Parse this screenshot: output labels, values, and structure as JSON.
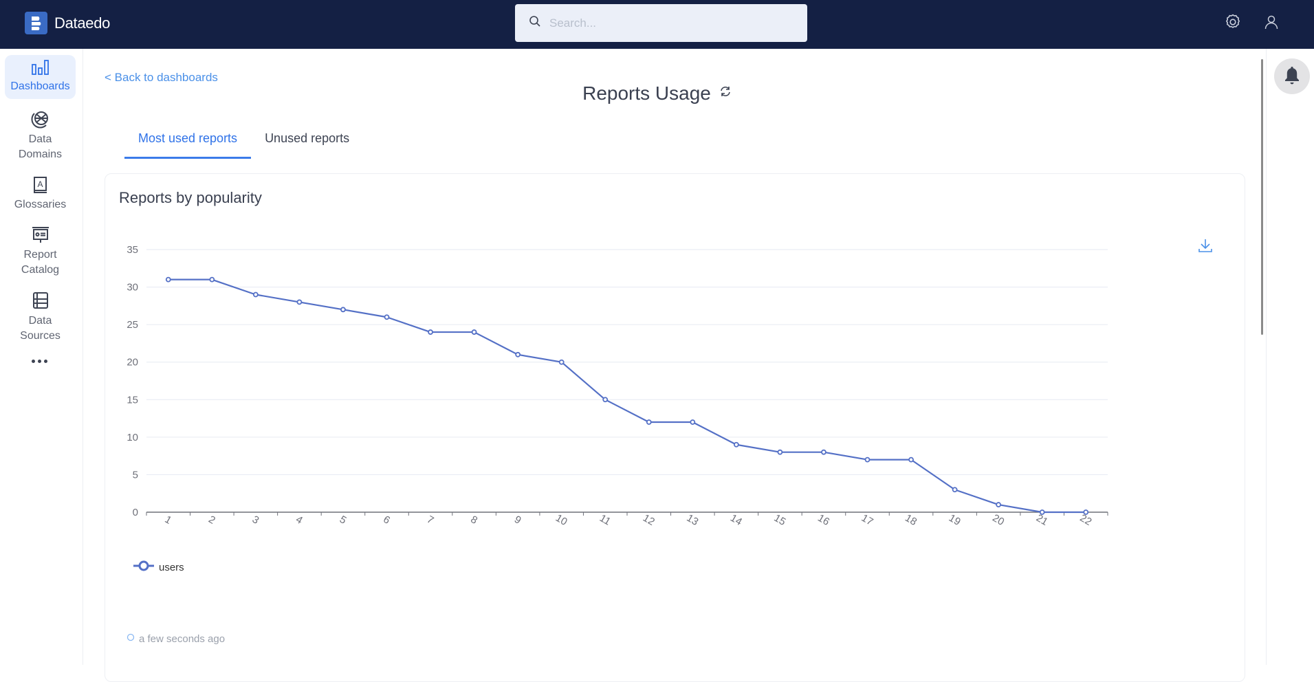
{
  "app": {
    "name": "Dataedo",
    "search_placeholder": "Search...",
    "search_value": ""
  },
  "sidebar": {
    "items": [
      {
        "id": "dashboards",
        "label": "Dashboards",
        "icon": "bar-chart-icon",
        "active": true
      },
      {
        "id": "data-domains",
        "label": "Data Domains",
        "icon": "globe-icon",
        "active": false
      },
      {
        "id": "glossaries",
        "label": "Glossaries",
        "icon": "glossary-book-icon",
        "active": false
      },
      {
        "id": "report-catalog",
        "label": "Report Catalog",
        "icon": "presentation-board-icon",
        "active": false
      },
      {
        "id": "data-sources",
        "label": "Data Sources",
        "icon": "table-list-icon",
        "active": false
      }
    ],
    "more_icon": "more-dots-icon"
  },
  "page": {
    "back_link": "< Back to dashboards",
    "title": "Reports Usage",
    "refresh_icon": "refresh-icon",
    "tabs": [
      {
        "label": "Most used reports",
        "active": true
      },
      {
        "label": "Unused reports",
        "active": false
      }
    ]
  },
  "card": {
    "title": "Reports by popularity",
    "download_icon": "download-icon",
    "updated_text": "a few seconds ago"
  },
  "colors": {
    "header_bg": "#142044",
    "accent": "#2f72e8",
    "series": "#5470c6",
    "grid": "#e6eaf2",
    "axis": "#6e7079"
  },
  "chart_data": {
    "type": "line",
    "title": "Reports by popularity",
    "xlabel": "",
    "ylabel": "",
    "categories": [
      "1",
      "2",
      "3",
      "4",
      "5",
      "6",
      "7",
      "8",
      "9",
      "10",
      "11",
      "12",
      "13",
      "14",
      "15",
      "16",
      "17",
      "18",
      "19",
      "20",
      "21",
      "22"
    ],
    "series": [
      {
        "name": "users",
        "values": [
          31,
          31,
          29,
          28,
          27,
          26,
          24,
          24,
          21,
          20,
          15,
          12,
          12,
          9,
          8,
          8,
          7,
          7,
          3,
          1,
          0,
          0
        ]
      }
    ],
    "yticks": [
      0,
      5,
      10,
      15,
      20,
      25,
      30,
      35
    ],
    "ylim": [
      0,
      35
    ],
    "grid": true,
    "legend": "bottom-left",
    "xtick_rotation": "rotated"
  }
}
